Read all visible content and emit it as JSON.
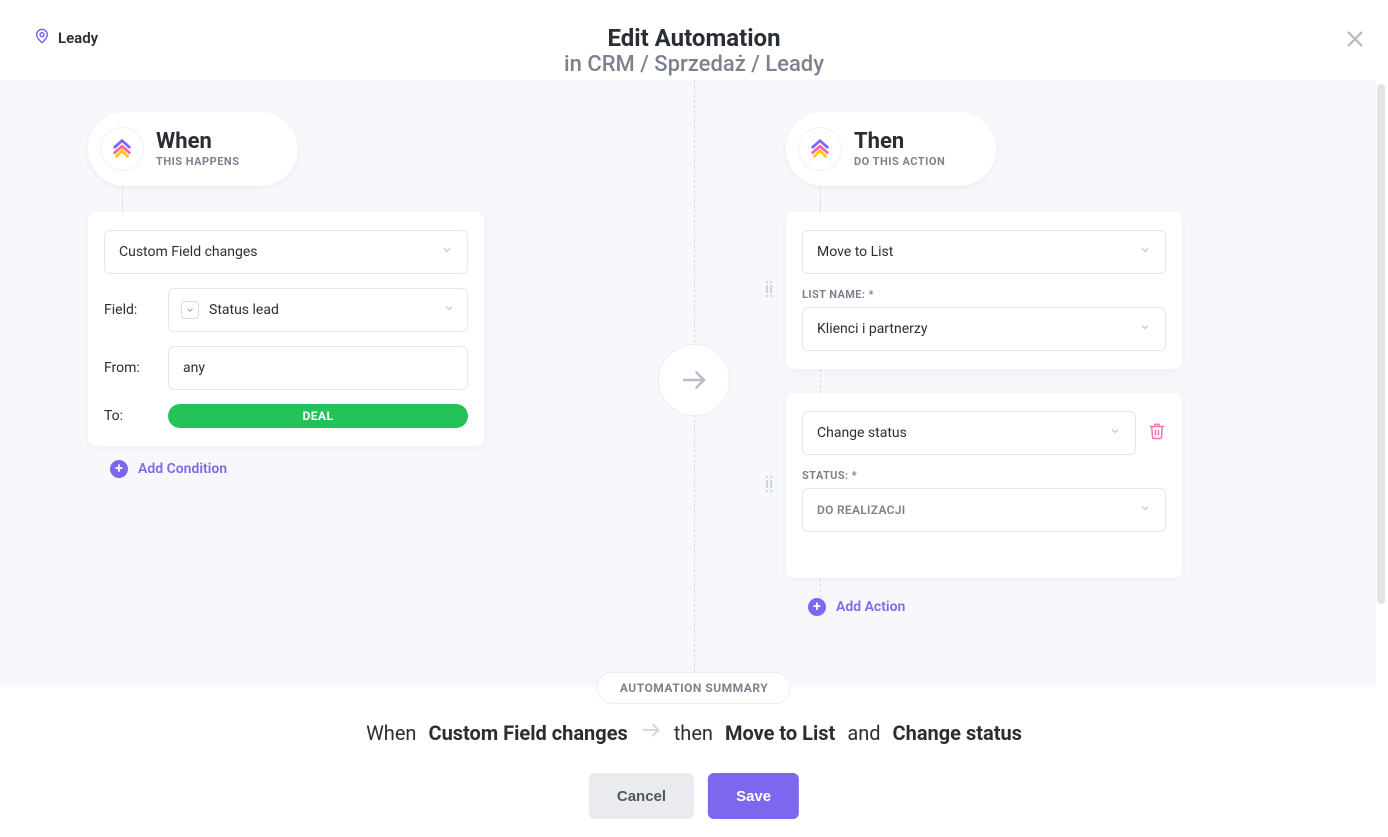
{
  "breadcrumb": {
    "label": "Leady"
  },
  "header": {
    "title": "Edit Automation",
    "subtitle": "in CRM / Sprzedaż / Leady"
  },
  "when": {
    "title": "When",
    "subtitle": "THIS HAPPENS",
    "trigger": "Custom Field changes",
    "field_label": "Field:",
    "field_value": "Status lead",
    "from_label": "From:",
    "from_value": "any",
    "to_label": "To:",
    "to_value": "DEAL",
    "add_condition": "Add Condition"
  },
  "then": {
    "title": "Then",
    "subtitle": "DO THIS ACTION",
    "actions": [
      {
        "type": "Move to List",
        "param_label": "LIST NAME: *",
        "param_value": "Klienci i partnerzy"
      },
      {
        "type": "Change status",
        "param_label": "STATUS: *",
        "param_value": "DO REALIZACJI"
      }
    ],
    "add_action": "Add Action"
  },
  "summary": {
    "label": "AUTOMATION SUMMARY",
    "when_word": "When",
    "when_value": "Custom Field changes",
    "then_word": "then",
    "then_value1": "Move to List",
    "and_word": "and",
    "then_value2": "Change status"
  },
  "buttons": {
    "cancel": "Cancel",
    "save": "Save"
  }
}
